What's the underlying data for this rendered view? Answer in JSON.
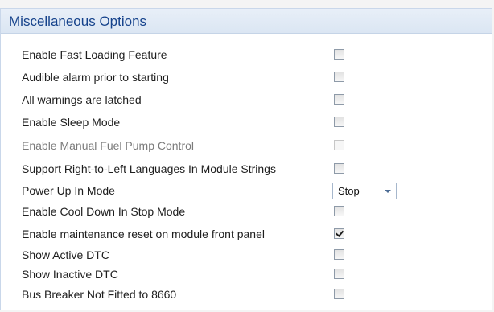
{
  "panel": {
    "title": "Miscellaneous Options"
  },
  "options": [
    {
      "label": "Enable Fast Loading Feature",
      "checked": false,
      "disabled": false
    },
    {
      "label": "Audible alarm prior to starting",
      "checked": false,
      "disabled": false
    },
    {
      "label": "All warnings are latched",
      "checked": false,
      "disabled": false
    },
    {
      "label": "Enable Sleep Mode",
      "checked": false,
      "disabled": false
    },
    {
      "label": "Enable Manual Fuel Pump Control",
      "checked": false,
      "disabled": true
    },
    {
      "label": "Support Right-to-Left Languages In Module Strings",
      "checked": false,
      "disabled": false
    },
    {
      "label": "Power Up In Mode",
      "select_value": "Stop",
      "disabled": false
    },
    {
      "label": "Enable Cool Down In Stop Mode",
      "checked": false,
      "disabled": false
    },
    {
      "label": "Enable maintenance reset on module front panel",
      "checked": true,
      "disabled": false
    },
    {
      "label": "Show Active DTC",
      "checked": false,
      "disabled": false
    },
    {
      "label": "Show Inactive DTC",
      "checked": false,
      "disabled": false
    },
    {
      "label": "Bus Breaker Not Fitted to 8660",
      "checked": false,
      "disabled": false
    }
  ],
  "icons": {
    "dropdown": "chevron-down-icon",
    "check": "check-icon"
  }
}
